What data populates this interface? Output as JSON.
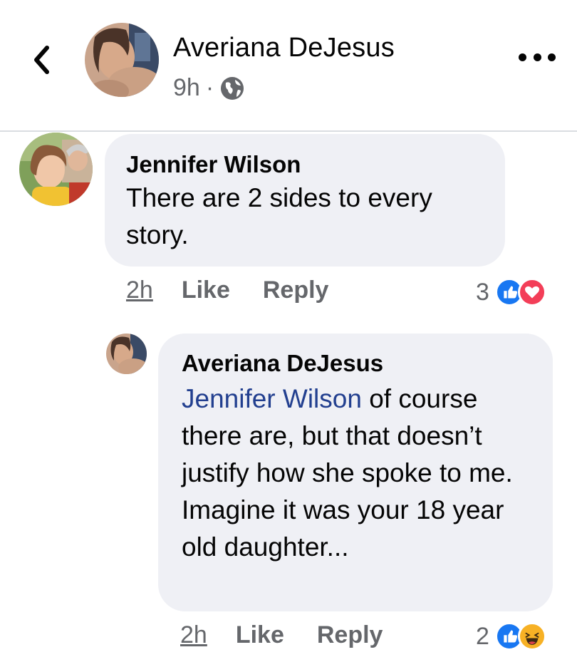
{
  "post": {
    "author_name": "Averiana DeJesus",
    "time": "9h",
    "separator": "·"
  },
  "comments": [
    {
      "author": "Jennifer Wilson",
      "text": "There are 2 sides to every story.",
      "time": "2h",
      "like_label": "Like",
      "reply_label": "Reply",
      "reaction_count": "3",
      "reactions": [
        "like-icon",
        "love-icon"
      ]
    },
    {
      "author": "Averiana DeJesus",
      "mention": "Jennifer Wilson",
      "text": " of course there are, but that doesn’t justify how she spoke to me. Imagine it was your 18 year old daughter...",
      "time": "2h",
      "like_label": "Like",
      "reply_label": "Reply",
      "reaction_count": "2",
      "reactions": [
        "like-icon",
        "haha-icon"
      ]
    }
  ],
  "colors": {
    "bubble": "#eff0f5",
    "mention": "#223f8f",
    "secondary_text": "#65676b",
    "like_blue": "#1877f2",
    "love_red": "#f33e58",
    "haha_yellow": "#f7b125"
  }
}
